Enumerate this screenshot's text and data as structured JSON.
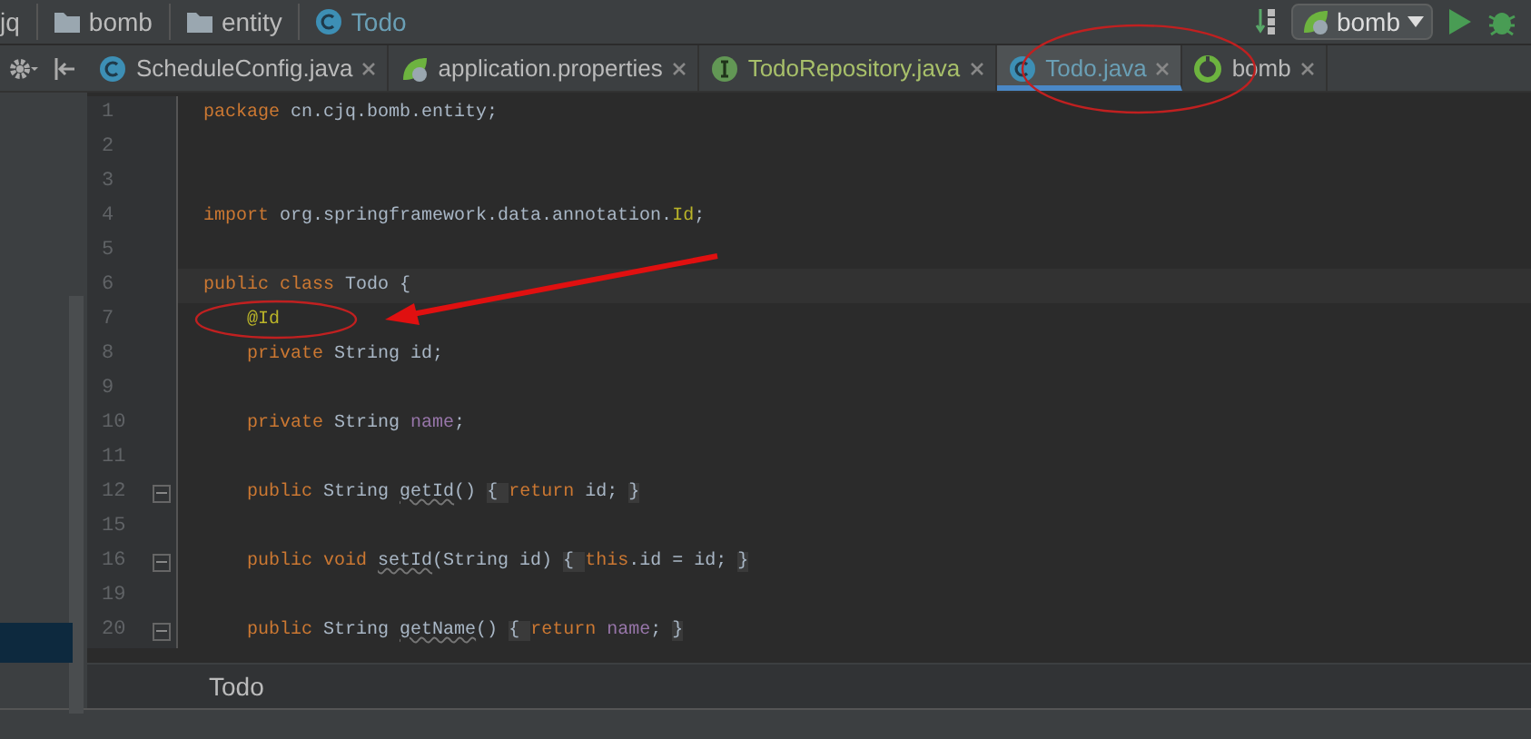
{
  "breadcrumbs": [
    {
      "label": "jq",
      "kind": "plain"
    },
    {
      "label": "bomb",
      "kind": "folder"
    },
    {
      "label": "entity",
      "kind": "folder"
    },
    {
      "label": "Todo",
      "kind": "class"
    }
  ],
  "run_config": {
    "label": "bomb"
  },
  "tabs": [
    {
      "label": "ScheduleConfig.java",
      "kind": "class",
      "selected": false,
      "color": "#bbbbbb"
    },
    {
      "label": "application.properties",
      "kind": "spring",
      "selected": false,
      "color": "#bbbbbb"
    },
    {
      "label": "TodoRepository.java",
      "kind": "interface",
      "selected": false,
      "color": "#a8c06a"
    },
    {
      "label": "Todo.java",
      "kind": "class",
      "selected": true,
      "color": "#6a9fb5"
    },
    {
      "label": "bomb",
      "kind": "boot",
      "selected": false,
      "color": "#bbbbbb"
    }
  ],
  "lines": [
    {
      "number": "1",
      "tokens": [
        {
          "kind": "keyword",
          "text": "package"
        },
        {
          "kind": "plain",
          "text": " cn.cjq.bomb.entity;"
        }
      ]
    },
    {
      "number": "2"
    },
    {
      "number": "3"
    },
    {
      "number": "4",
      "tokens": [
        {
          "kind": "keyword",
          "text": "import"
        },
        {
          "kind": "plain",
          "text": " org.springframework.data.annotation."
        },
        {
          "kind": "annotation",
          "text": "Id"
        },
        {
          "kind": "plain",
          "text": ";"
        }
      ]
    },
    {
      "number": "5"
    },
    {
      "number": "6",
      "current": true,
      "tokens": [
        {
          "kind": "keyword",
          "text": "public class"
        },
        {
          "kind": "plain",
          "text": " Todo {"
        }
      ]
    },
    {
      "number": "7",
      "indented": true,
      "tokens": [
        {
          "kind": "annotation",
          "text": "@Id"
        }
      ]
    },
    {
      "number": "8",
      "indented": true,
      "tokens": [
        {
          "kind": "keyword",
          "text": "private"
        },
        {
          "kind": "plain",
          "text": " String id;"
        }
      ]
    },
    {
      "number": "9"
    },
    {
      "number": "10",
      "indented": true,
      "tokens": [
        {
          "kind": "keyword",
          "text": "private"
        },
        {
          "kind": "plain",
          "text": " String "
        },
        {
          "kind": "field",
          "text": "name"
        },
        {
          "kind": "plain",
          "text": ";"
        }
      ]
    },
    {
      "number": "11"
    },
    {
      "number": "12",
      "fold": true,
      "indented": true,
      "tokens": [
        {
          "kind": "keyword",
          "text": "public"
        },
        {
          "kind": "plain",
          "text": " String "
        },
        {
          "kind": "method",
          "text": "getId"
        },
        {
          "kind": "plain",
          "text": "() "
        },
        {
          "kind": "folded",
          "text": "{ "
        },
        {
          "kind": "keyword",
          "text": "return"
        },
        {
          "kind": "plain",
          "text": " id; "
        },
        {
          "kind": "folded",
          "text": "}"
        }
      ]
    },
    {
      "number": "15"
    },
    {
      "number": "16",
      "fold": true,
      "indented": true,
      "tokens": [
        {
          "kind": "keyword",
          "text": "public void "
        },
        {
          "kind": "method",
          "text": "setId"
        },
        {
          "kind": "plain",
          "text": "(String id) "
        },
        {
          "kind": "folded",
          "text": "{ "
        },
        {
          "kind": "keyword",
          "text": "this"
        },
        {
          "kind": "plain",
          "text": ".id = id; "
        },
        {
          "kind": "folded",
          "text": "}"
        }
      ]
    },
    {
      "number": "19"
    },
    {
      "number": "20",
      "fold": true,
      "indented": true,
      "tokens": [
        {
          "kind": "keyword",
          "text": "public"
        },
        {
          "kind": "plain",
          "text": " String "
        },
        {
          "kind": "method",
          "text": "getName"
        },
        {
          "kind": "plain",
          "text": "() "
        },
        {
          "kind": "folded",
          "text": "{ "
        },
        {
          "kind": "keyword",
          "text": "return "
        },
        {
          "kind": "field",
          "text": "name"
        },
        {
          "kind": "plain",
          "text": "; "
        },
        {
          "kind": "folded",
          "text": "}"
        }
      ]
    }
  ],
  "editor_breadcrumb": "Todo"
}
